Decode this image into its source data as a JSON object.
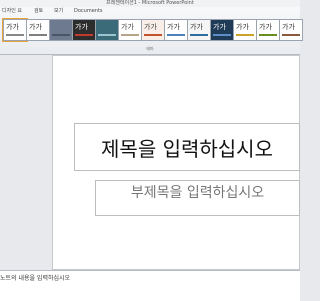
{
  "window": {
    "title": "프레젠테이션1 - Microsoft PowerPoint"
  },
  "ribbon": {
    "tabs": [
      "디자인 요",
      "검토",
      "보기",
      "Documents"
    ],
    "gallery_label": "테마",
    "themes": [
      {
        "text": "가가",
        "bg": "#ffffff",
        "fg": "#333333",
        "bar": "#888888"
      },
      {
        "text": "가가",
        "bg": "#ffffff",
        "fg": "#333333",
        "bar": "#7f7f7f"
      },
      {
        "text": "",
        "bg": "#6d7a8f",
        "fg": "#ffffff",
        "bar": "#4a5568"
      },
      {
        "text": "가가",
        "bg": "#2d2d2d",
        "fg": "#ffffff",
        "bar": "#c0392b"
      },
      {
        "text": "",
        "bg": "#3b6a79",
        "fg": "#ffffff",
        "bar": "#9bc4cf"
      },
      {
        "text": "가가",
        "bg": "#ffffff",
        "fg": "#444444",
        "bar": "#b6a48a"
      },
      {
        "text": "가가",
        "bg": "#f9efe8",
        "fg": "#444444",
        "bar": "#c2542d"
      },
      {
        "text": "가가",
        "bg": "#ffffff",
        "fg": "#333333",
        "bar": "#4f81bd"
      },
      {
        "text": "가가",
        "bg": "#f5f5f5",
        "fg": "#333333",
        "bar": "#2f6f9f"
      },
      {
        "text": "가가",
        "bg": "#1f3b57",
        "fg": "#ffffff",
        "bar": "#5d8fc6"
      },
      {
        "text": "가가",
        "bg": "#ffffff",
        "fg": "#333333",
        "bar": "#c9a227"
      },
      {
        "text": "가가",
        "bg": "#ffffff",
        "fg": "#333333",
        "bar": "#6b8e23"
      },
      {
        "text": "가가",
        "bg": "#ffffff",
        "fg": "#333333",
        "bar": "#8a5a3b"
      }
    ]
  },
  "slide": {
    "title_placeholder": "제목을 입력하십시오",
    "subtitle_placeholder": "부제목을 입력하십시오"
  },
  "notes": {
    "placeholder": "노트의 내용을 입력하십시오"
  }
}
